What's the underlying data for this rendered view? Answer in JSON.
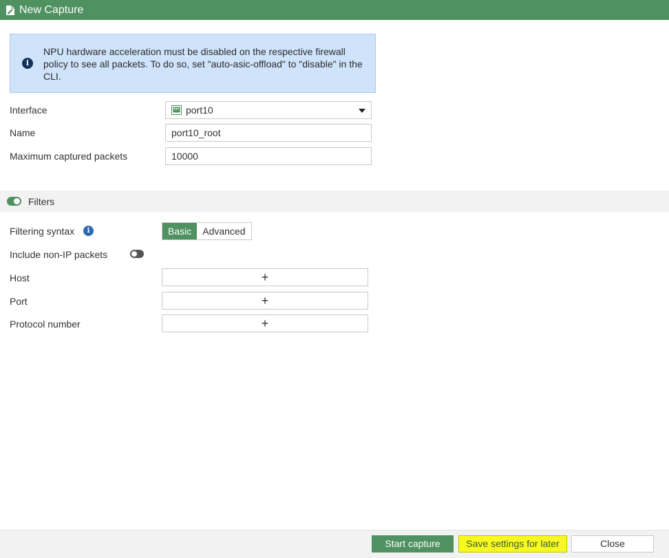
{
  "window": {
    "title": "New Capture",
    "title_icon": "document-edit-icon"
  },
  "notice": {
    "icon": "info-icon",
    "text": "NPU hardware acceleration must be disabled on the respective firewall policy to see all packets. To do so, set \"auto-asic-offload\" to \"disable\" in the CLI."
  },
  "form": {
    "interface": {
      "label": "Interface",
      "value": "port10",
      "icon": "ethernet-port-icon"
    },
    "name": {
      "label": "Name",
      "value": "port10_root"
    },
    "max_packets": {
      "label": "Maximum captured packets",
      "value": "10000"
    }
  },
  "filters": {
    "section_label": "Filters",
    "enabled": true,
    "syntax": {
      "label": "Filtering syntax",
      "options": [
        "Basic",
        "Advanced"
      ],
      "selected": "Basic"
    },
    "include_non_ip": {
      "label": "Include non-IP packets",
      "enabled": false
    },
    "host": {
      "label": "Host",
      "add_symbol": "+"
    },
    "port": {
      "label": "Port",
      "add_symbol": "+"
    },
    "protocol": {
      "label": "Protocol number",
      "add_symbol": "+"
    }
  },
  "footer": {
    "start_label": "Start capture",
    "save_label": "Save settings for later",
    "close_label": "Close"
  },
  "colors": {
    "accent": "#4f9160",
    "info_bg": "#cfe3fb",
    "highlight": "#f7f91f"
  }
}
